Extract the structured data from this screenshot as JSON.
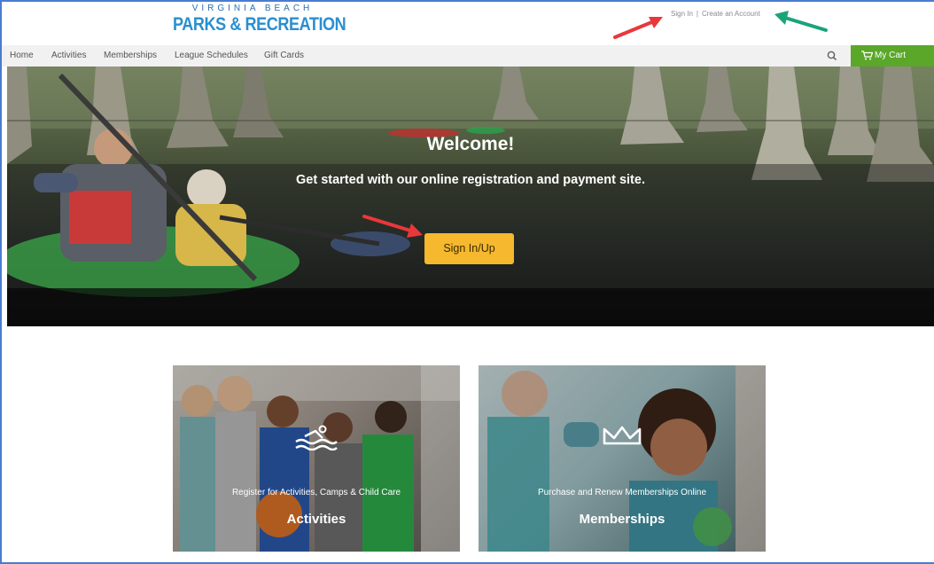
{
  "header": {
    "logo_top": "VIRGINIA BEACH",
    "logo_main": "PARKS & RECREATION",
    "sign_in": "Sign In",
    "separator": "|",
    "create_account": "Create an Account"
  },
  "nav": {
    "items": [
      {
        "label": "Home"
      },
      {
        "label": "Activities"
      },
      {
        "label": "Memberships"
      },
      {
        "label": "League Schedules"
      },
      {
        "label": "Gift Cards"
      }
    ],
    "search_icon": "search-icon",
    "cart_label": "My Cart",
    "cart_icon": "cart-icon"
  },
  "hero": {
    "title": "Welcome!",
    "tagline": "Get started with our online registration and payment site.",
    "button": "Sign In/Up"
  },
  "cards": [
    {
      "subtitle": "Register for Activities, Camps & Child Care",
      "title": "Activities",
      "icon": "swimming-icon"
    },
    {
      "subtitle": "Purchase and Renew Memberships Online",
      "title": "Memberships",
      "icon": "crown-icon"
    }
  ],
  "colors": {
    "brand_blue": "#2a8fd0",
    "cart_green": "#5aa72a",
    "button_yellow": "#f5b82e",
    "annotation_red": "#e8383b",
    "annotation_green": "#1aa37a"
  }
}
